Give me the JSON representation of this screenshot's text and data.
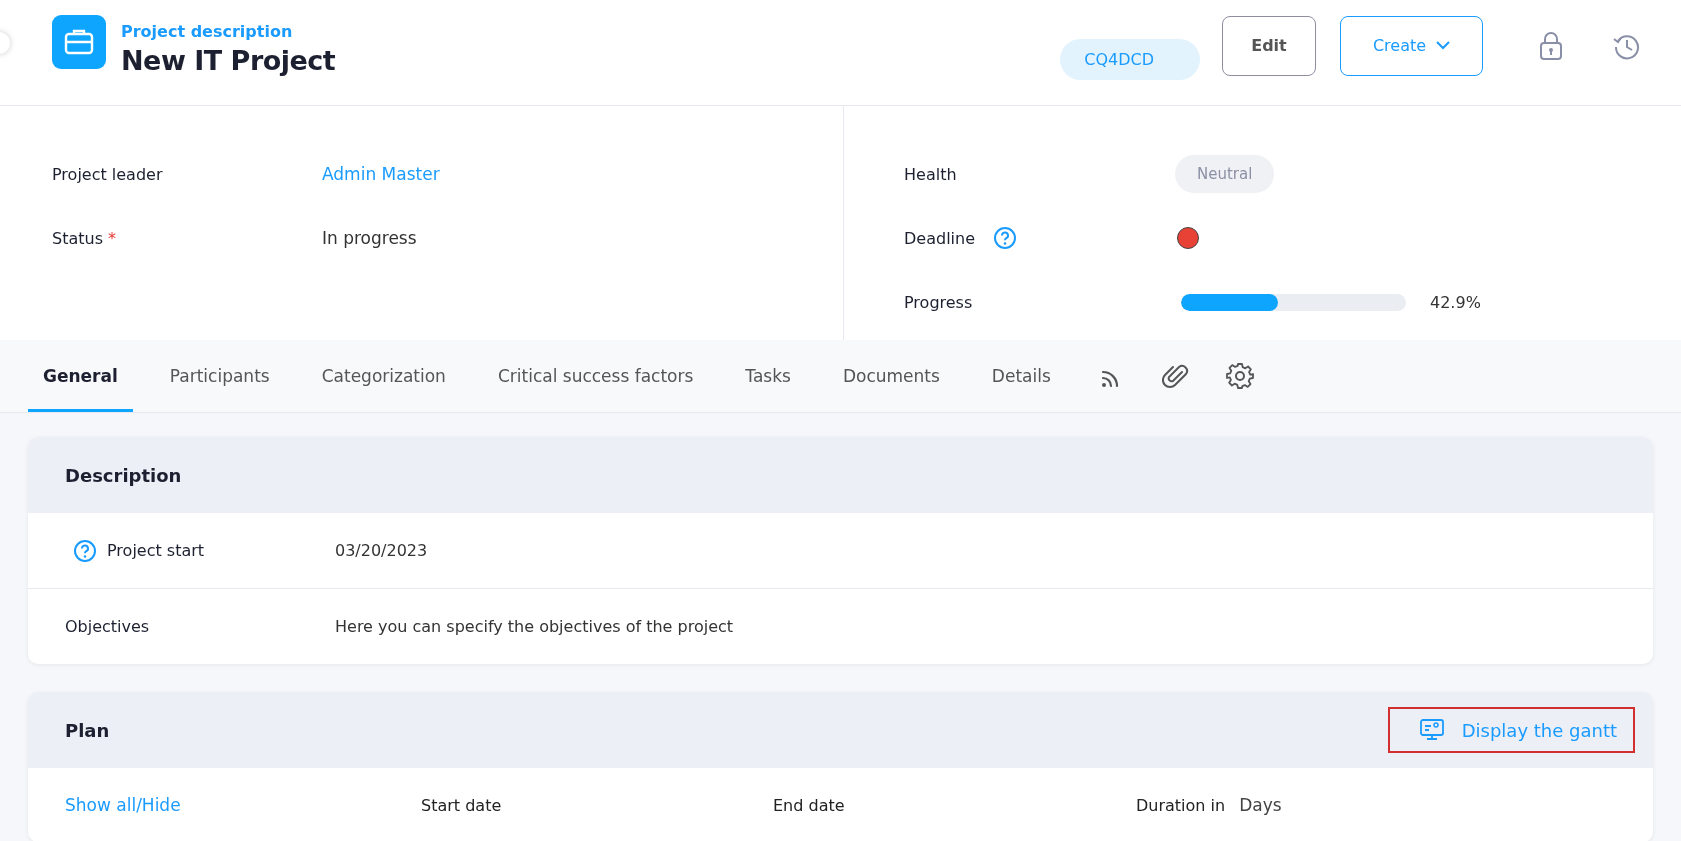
{
  "header": {
    "subtitle": "Project description",
    "title": "New IT Project",
    "code": "CQ4DCD",
    "buttons": [
      {
        "kind": "outline",
        "label": "Edit"
      },
      {
        "kind": "dropdown",
        "label": "Create"
      }
    ]
  },
  "fields_left": [
    {
      "label": "Project leader",
      "value": "Admin Master",
      "kind": "link"
    },
    {
      "label": "Status",
      "value": "In progress",
      "kind": "text",
      "required_mark": "*"
    }
  ],
  "fields_right": [
    {
      "label": "Health",
      "kind": "badge",
      "value": "Neutral"
    },
    {
      "label": "Deadline",
      "kind": "dot",
      "help": true,
      "color": "#e84135"
    },
    {
      "label": "Progress",
      "kind": "progress",
      "level": 0.429,
      "reading": "42.9%"
    }
  ],
  "tabs": [
    {
      "label": "General",
      "selected": true
    },
    {
      "label": "Participants",
      "selected": false
    },
    {
      "label": "Categorization",
      "selected": false
    },
    {
      "label": "Critical success factors",
      "selected": false
    },
    {
      "label": "Tasks",
      "selected": false
    },
    {
      "label": "Documents",
      "selected": false
    },
    {
      "label": "Details",
      "selected": false
    }
  ],
  "description": {
    "title": "Description",
    "rows": [
      {
        "label": "Project start",
        "help": true,
        "value": "03/20/2023"
      },
      {
        "label": "Objectives",
        "help": false,
        "value": "Here you can specify the objectives of the project"
      }
    ]
  },
  "plan": {
    "title": "Plan",
    "action": {
      "label": "Display the gantt",
      "highlighted": true
    },
    "toggle": "Show all/Hide",
    "columns": [
      "Start date",
      "End date",
      "Duration in"
    ],
    "duration_unit": "Days"
  }
}
